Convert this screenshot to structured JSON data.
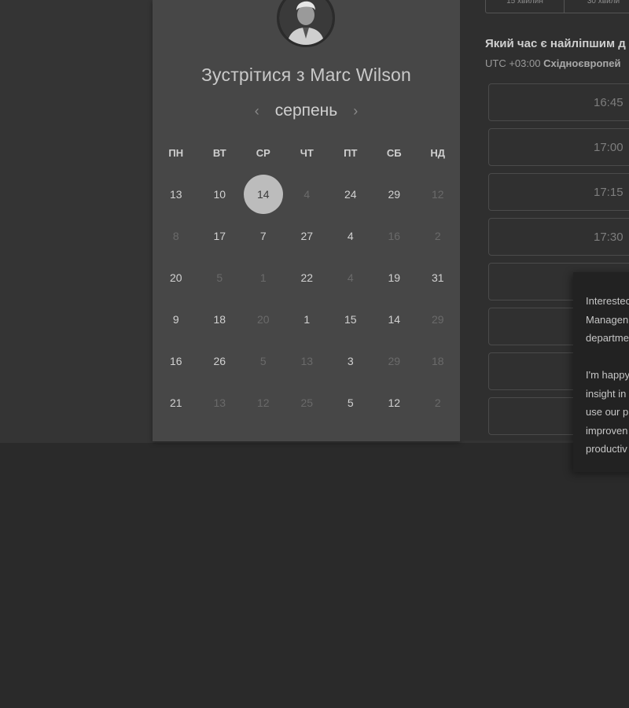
{
  "calendar": {
    "title": "Зустрітися з Marc Wilson",
    "month": "серпень",
    "weekdays": [
      "ПН",
      "ВТ",
      "СР",
      "ЧТ",
      "ПТ",
      "СБ",
      "НД"
    ],
    "rows": [
      [
        {
          "d": "13",
          "m": false
        },
        {
          "d": "10",
          "m": false
        },
        {
          "d": "14",
          "m": false,
          "sel": true
        },
        {
          "d": "4",
          "m": true
        },
        {
          "d": "24",
          "m": false
        },
        {
          "d": "29",
          "m": false
        },
        {
          "d": "12",
          "m": true
        }
      ],
      [
        {
          "d": "8",
          "m": true
        },
        {
          "d": "17",
          "m": false
        },
        {
          "d": "7",
          "m": false
        },
        {
          "d": "27",
          "m": false
        },
        {
          "d": "4",
          "m": false
        },
        {
          "d": "16",
          "m": true
        },
        {
          "d": "2",
          "m": true
        }
      ],
      [
        {
          "d": "20",
          "m": false
        },
        {
          "d": "5",
          "m": true
        },
        {
          "d": "1",
          "m": true
        },
        {
          "d": "22",
          "m": false
        },
        {
          "d": "4",
          "m": true
        },
        {
          "d": "19",
          "m": false
        },
        {
          "d": "31",
          "m": false
        }
      ],
      [
        {
          "d": "9",
          "m": false
        },
        {
          "d": "18",
          "m": false
        },
        {
          "d": "20",
          "m": true
        },
        {
          "d": "1",
          "m": false
        },
        {
          "d": "15",
          "m": false
        },
        {
          "d": "14",
          "m": false
        },
        {
          "d": "29",
          "m": true
        }
      ],
      [
        {
          "d": "16",
          "m": false
        },
        {
          "d": "26",
          "m": false
        },
        {
          "d": "5",
          "m": true
        },
        {
          "d": "13",
          "m": true
        },
        {
          "d": "3",
          "m": false
        },
        {
          "d": "29",
          "m": true
        },
        {
          "d": "18",
          "m": true
        }
      ],
      [
        {
          "d": "21",
          "m": false
        },
        {
          "d": "13",
          "m": true
        },
        {
          "d": "12",
          "m": true
        },
        {
          "d": "25",
          "m": true
        },
        {
          "d": "5",
          "m": false
        },
        {
          "d": "12",
          "m": false
        },
        {
          "d": "2",
          "m": true
        }
      ]
    ]
  },
  "scheduler": {
    "durations": [
      "15 хвилин",
      "30 хвили"
    ],
    "question": "Який час є найліпшим д",
    "timezone_offset": "UTC +03:00",
    "timezone_name": "Східноєвропей",
    "slots": [
      "16:45",
      "17:00",
      "17:15",
      "17:30",
      "",
      "",
      "",
      ""
    ]
  },
  "popover": {
    "lines": [
      "Interestec",
      "Managen",
      "departme",
      "",
      "I'm happy",
      "insight in",
      "use our p",
      "improven",
      "productiv"
    ]
  }
}
